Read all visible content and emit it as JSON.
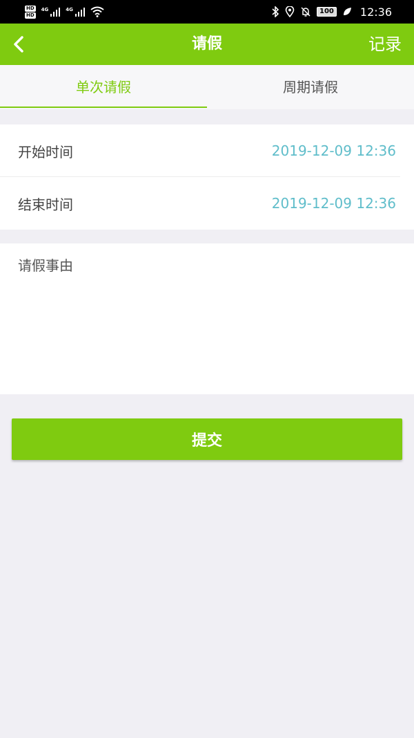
{
  "status_bar": {
    "hd1": "HD",
    "hd2": "HD",
    "net1": "4G",
    "net2": "4G",
    "battery": "100",
    "time": "12:36"
  },
  "nav": {
    "title": "请假",
    "record": "记录"
  },
  "tabs": [
    {
      "label": "单次请假",
      "active": true
    },
    {
      "label": "周期请假",
      "active": false
    }
  ],
  "form": {
    "start_label": "开始时间",
    "start_value": "2019-12-09 12:36",
    "end_label": "结束时间",
    "end_value": "2019-12-09 12:36",
    "reason_placeholder": "请假事由"
  },
  "submit_label": "提交",
  "colors": {
    "accent": "#7fcb10",
    "time_value": "#5fbdca",
    "background": "#f0eff4"
  }
}
